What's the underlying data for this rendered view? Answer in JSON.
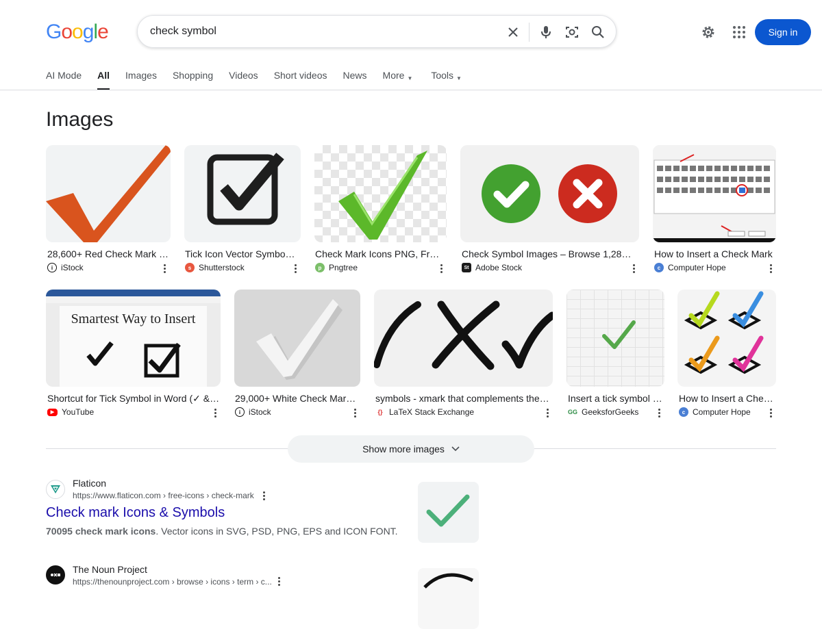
{
  "search": {
    "query": "check symbol"
  },
  "header": {
    "logo_text": "Google",
    "sign_in": "Sign in"
  },
  "tabs": [
    {
      "label": "AI Mode"
    },
    {
      "label": "All"
    },
    {
      "label": "Images"
    },
    {
      "label": "Shopping"
    },
    {
      "label": "Videos"
    },
    {
      "label": "Short videos"
    },
    {
      "label": "News"
    },
    {
      "label": "More"
    },
    {
      "label": "Tools"
    }
  ],
  "images_section": {
    "title": "Images",
    "cards": [
      {
        "caption": "28,600+ Red Check Mark S...",
        "source": "iStock"
      },
      {
        "caption": "Tick Icon Vector Symbol ...",
        "source": "Shutterstock"
      },
      {
        "caption": "Check Mark Icons PNG, Free ...",
        "source": "Pngtree"
      },
      {
        "caption": "Check Symbol Images – Browse 1,288,4...",
        "source": "Adobe Stock"
      },
      {
        "caption": "How to Insert a Check Mark",
        "source": "Computer Hope"
      },
      {
        "caption": "Shortcut for Tick Symbol in Word (✓ & ☐...",
        "source": "YouTube",
        "thumb_text": "Smartest Way to Insert"
      },
      {
        "caption": "29,000+ White Check Mark...",
        "source": "iStock"
      },
      {
        "caption": "symbols - xmark that complements the ...",
        "source": "LaTeX Stack Exchange"
      },
      {
        "caption": "Insert a tick symbol (...",
        "source": "GeeksforGeeks"
      },
      {
        "caption": "How to Insert a Chec...",
        "source": "Computer Hope"
      }
    ],
    "show_more": "Show more images"
  },
  "results": [
    {
      "site": "Flaticon",
      "url": "https://www.flaticon.com › free-icons › check-mark",
      "title": "Check mark Icons & Symbols",
      "snippet_bold": "70095 check mark icons",
      "snippet_rest": ". Vector icons in SVG, PSD, PNG, EPS and ICON FONT."
    },
    {
      "site": "The Noun Project",
      "url": "https://thenounproject.com › browse › icons › term › c..."
    }
  ],
  "colors": {
    "accent": "#0b57d0",
    "link": "#1a0dab",
    "text": "#202124",
    "muted": "#4d5156"
  }
}
